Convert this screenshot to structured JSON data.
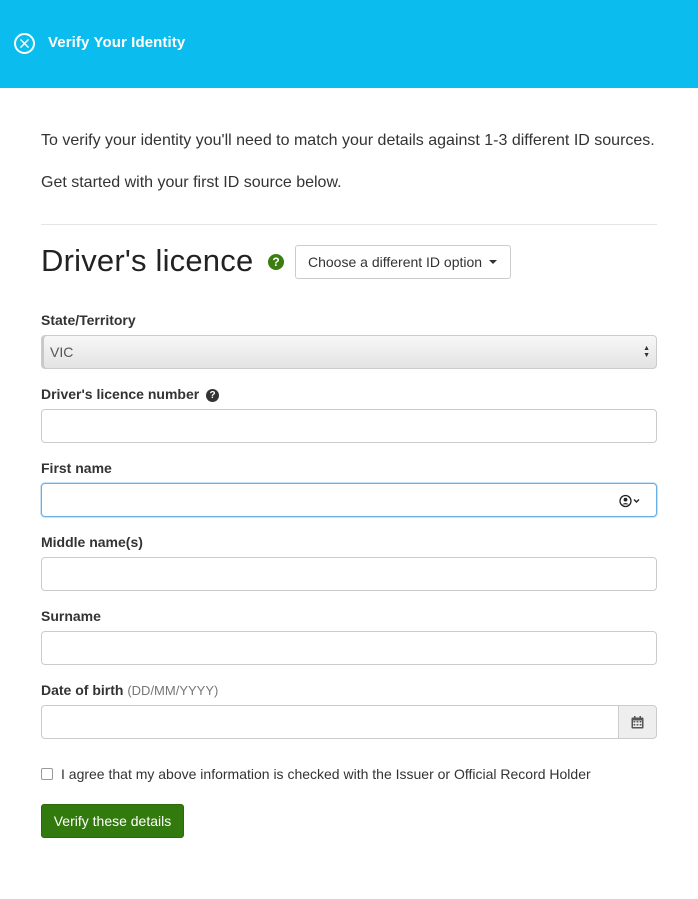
{
  "header": {
    "title": "Verify Your Identity",
    "close_icon": "close-circle-icon",
    "background_color": "#0bbdee"
  },
  "intro": {
    "line1": "To verify your identity you'll need to match your details against 1-3 different ID sources.",
    "line2": "Get started with your first ID source below."
  },
  "section": {
    "title": "Driver's licence",
    "help_icon": "?",
    "choose_option_label": "Choose a different ID option"
  },
  "form": {
    "state_label": "State/Territory",
    "state_value": "VIC",
    "licence_label": "Driver's licence number",
    "licence_help_icon": "?",
    "licence_value": "",
    "first_name_label": "First name",
    "first_name_value": "",
    "middle_name_label": "Middle name(s)",
    "middle_name_value": "",
    "surname_label": "Surname",
    "surname_value": "",
    "dob_label": "Date of birth",
    "dob_hint": "(DD/MM/YYYY)",
    "dob_value": "",
    "agree_label": "I agree that my above information is checked with the Issuer or Official Record Holder",
    "agree_checked": false,
    "submit_label": "Verify these details"
  },
  "colors": {
    "accent_green": "#337a0e",
    "focus_blue": "#66afe9"
  }
}
